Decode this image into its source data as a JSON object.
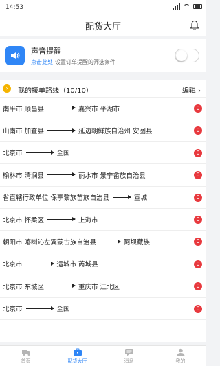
{
  "status_bar": {
    "time": "14:53"
  },
  "header": {
    "title": "配货大厅"
  },
  "notify": {
    "title": "声音提醒",
    "link": "点击此处",
    "desc": "设置订单提醒的筛选条件",
    "enabled": false
  },
  "routes": {
    "badge": "🚚",
    "title": "我的接单路线（10/10）",
    "edit_label": "编辑 ›",
    "items": [
      {
        "from": "南平市 顺昌县",
        "to": "嘉兴市 平湖市",
        "count": "0"
      },
      {
        "from": "山南市 加查县",
        "to": "延边朝鲜族自治州 安图县",
        "count": "0"
      },
      {
        "from": "北京市",
        "to": "全国",
        "count": "0"
      },
      {
        "from": "榆林市 清涧县",
        "to": "丽水市 景宁畲族自治县",
        "count": "0"
      },
      {
        "from": "省直辖行政单位 保亭黎族苗族自治县",
        "to": "宣城",
        "count": "0"
      },
      {
        "from": "北京市 怀柔区",
        "to": "上海市",
        "count": "0"
      },
      {
        "from": "朝阳市 喀喇沁左翼蒙古族自治县",
        "to": "阿坝藏族",
        "count": "0"
      },
      {
        "from": "北京市",
        "to": "运城市 芮城县",
        "count": "0"
      },
      {
        "from": "北京市 东城区",
        "to": "重庆市 江北区",
        "count": "0"
      },
      {
        "from": "北京市",
        "to": "全国",
        "count": "0"
      }
    ]
  },
  "tabbar": {
    "items": [
      {
        "label": "首页",
        "icon": "truck-icon",
        "active": false
      },
      {
        "label": "配货大厅",
        "icon": "briefcase-icon",
        "active": true
      },
      {
        "label": "消息",
        "icon": "message-icon",
        "active": false
      },
      {
        "label": "我的",
        "icon": "person-icon",
        "active": false
      }
    ]
  },
  "colors": {
    "accent": "#2f86f6",
    "badge_red": "#e8393e",
    "route_badge": "#f5b400"
  }
}
